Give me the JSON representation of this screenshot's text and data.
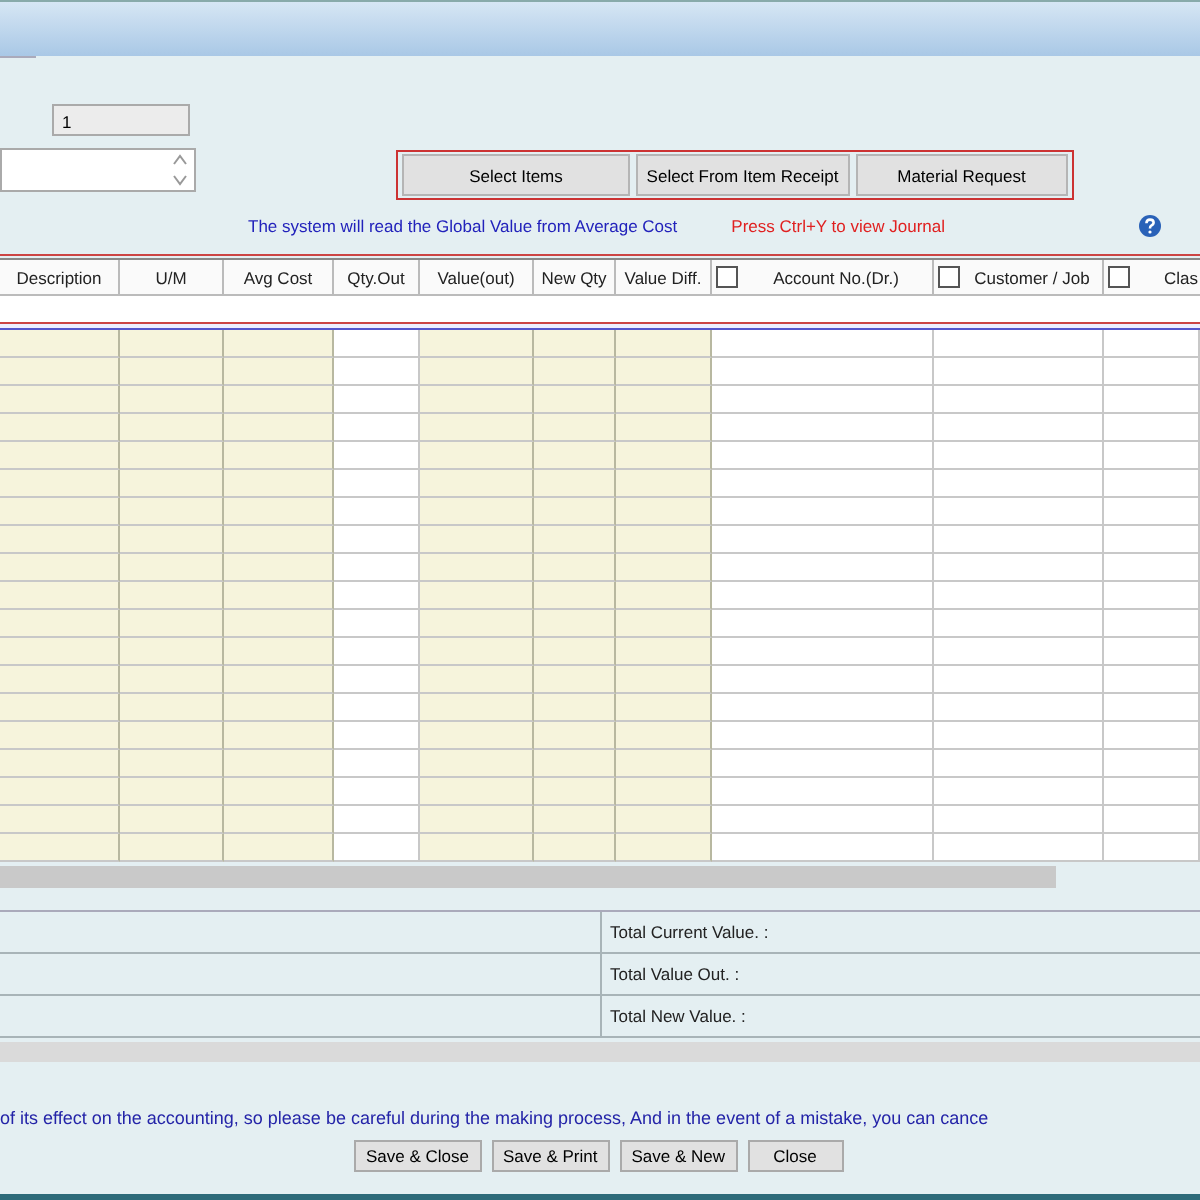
{
  "form": {
    "number_field": {
      "value": "1"
    },
    "buttons": [
      {
        "label": "Select Items"
      },
      {
        "label": "Select From Item Receipt"
      },
      {
        "label": "Material Request"
      }
    ],
    "info_text": "The system will read the Global Value from Average Cost",
    "journal_hint": "Press Ctrl+Y to view Journal"
  },
  "table": {
    "columns": [
      {
        "label": "Description",
        "readonly": true
      },
      {
        "label": "U/M",
        "readonly": true
      },
      {
        "label": "Avg Cost",
        "readonly": true
      },
      {
        "label": "Qty.Out",
        "readonly": false
      },
      {
        "label": "Value(out)",
        "readonly": true
      },
      {
        "label": "New Qty",
        "readonly": true
      },
      {
        "label": "Value Diff.",
        "readonly": true
      },
      {
        "label": "Account No.(Dr.)",
        "readonly": false,
        "checkbox": {
          "checked": false
        }
      },
      {
        "label": "Customer / Job",
        "readonly": false,
        "checkbox": {
          "checked": false
        }
      },
      {
        "label": "Clas",
        "readonly": false,
        "checkbox": {
          "checked": false
        }
      }
    ]
  },
  "totals": [
    {
      "label": "Total Current Value. :"
    },
    {
      "label": "Total Value Out. :"
    },
    {
      "label": "Total New Value. :"
    }
  ],
  "notice": "of its effect on the accounting, so please be careful during the making process, And in the event of a mistake, you can cance",
  "actions": [
    {
      "label": "Save & Close"
    },
    {
      "label": "Save & Print"
    },
    {
      "label": "Save & New"
    },
    {
      "label": "Close"
    }
  ]
}
